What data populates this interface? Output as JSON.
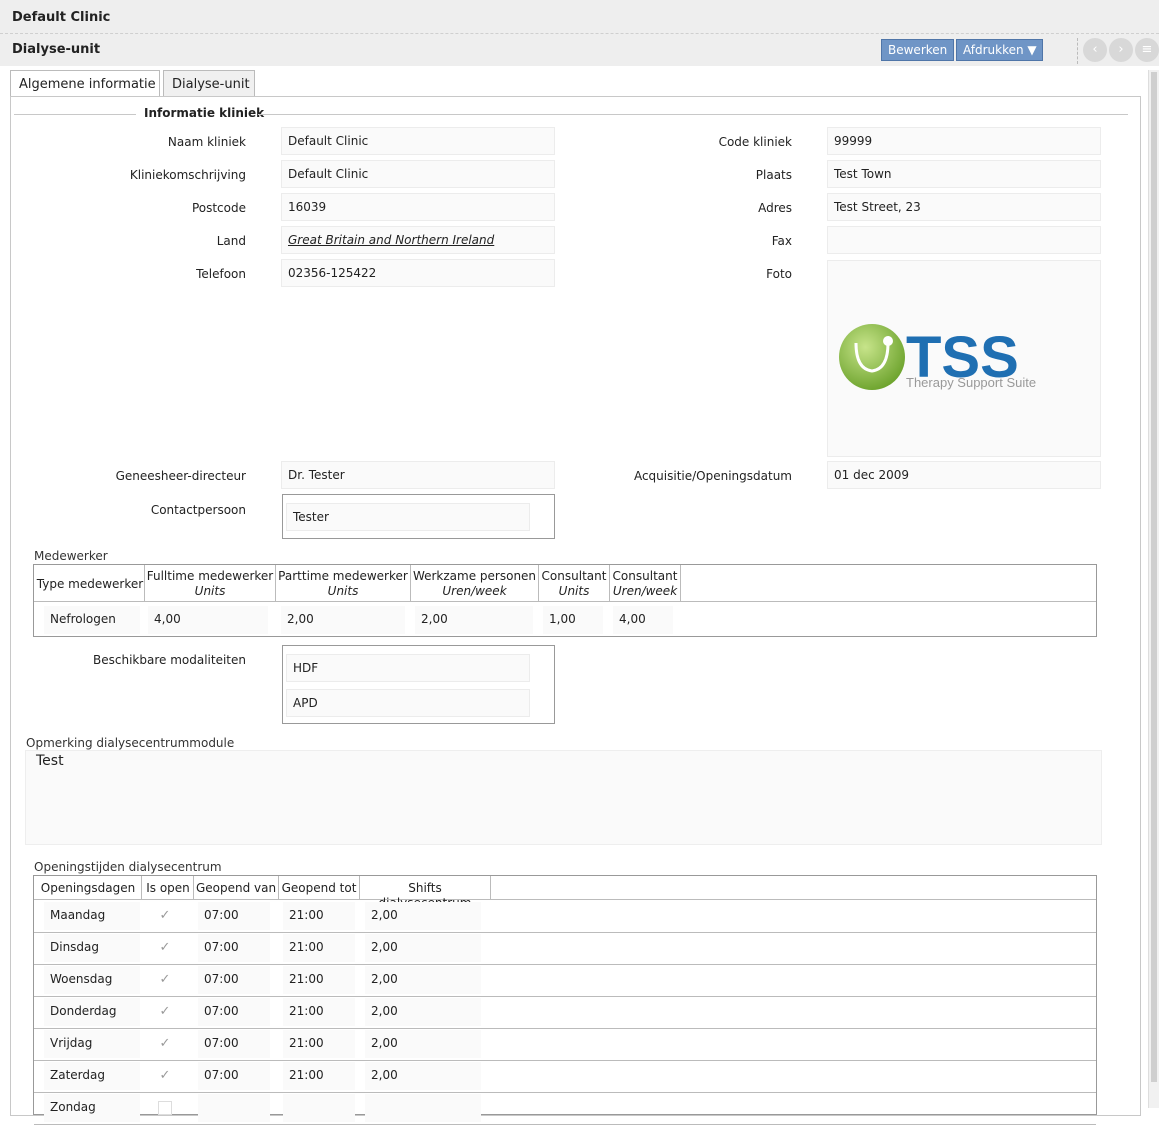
{
  "header": {
    "title": "Default Clinic",
    "subtitle": "Dialyse-unit"
  },
  "toolbar": {
    "edit_label": "Bewerken",
    "print_label": "Afdrukken ▼"
  },
  "tabs": [
    {
      "label": "Algemene informatie"
    },
    {
      "label": "Dialyse-unit"
    }
  ],
  "clinic_info": {
    "legend": "Informatie kliniek",
    "name_label": "Naam kliniek",
    "name_value": "Default Clinic",
    "desc_label": "Kliniekomschrijving",
    "desc_value": "Default Clinic",
    "postcode_label": "Postcode",
    "postcode_value": "16039",
    "country_label": "Land",
    "country_value": "Great Britain and Northern Ireland",
    "phone_label": "Telefoon",
    "phone_value": "02356-125422",
    "code_label": "Code kliniek",
    "code_value": "99999",
    "city_label": "Plaats",
    "city_value": "Test Town",
    "address_label": "Adres",
    "address_value": "Test Street, 23",
    "fax_label": "Fax",
    "fax_value": "",
    "photo_label": "Foto",
    "logo_main": "TSS",
    "logo_sub": "Therapy Support Suite",
    "director_label": "Geneesheer-directeur",
    "director_value": "Dr. Tester",
    "opening_label": "Acquisitie/Openingsdatum",
    "opening_value": "01 dec 2009",
    "contact_label": "Contactpersoon",
    "contact_value": "Tester"
  },
  "staff": {
    "legend": "Medewerker",
    "headers": {
      "type": "Type medewerker",
      "fulltime": "Fulltime medewerker",
      "fulltime_unit": "Units",
      "parttime": "Parttime medewerker",
      "parttime_unit": "Units",
      "working": "Werkzame personen",
      "working_unit": "Uren/week",
      "consultant1": "Consultant",
      "consultant1_unit": "Units",
      "consultant2": "Consultant",
      "consultant2_unit": "Uren/week"
    },
    "rows": [
      {
        "type": "Nefrologen",
        "fulltime": "4,00",
        "parttime": "2,00",
        "working": "2,00",
        "consultant_units": "1,00",
        "consultant_hours": "4,00"
      }
    ]
  },
  "modalities": {
    "label": "Beschikbare modaliteiten",
    "items": [
      "HDF",
      "APD"
    ]
  },
  "remark": {
    "label": "Opmerking dialysecentrummodule",
    "value": "Test"
  },
  "hours": {
    "legend": "Openingstijden dialysecentrum",
    "headers": {
      "day": "Openingsdagen",
      "open": "Is open",
      "from": "Geopend van",
      "to": "Geopend tot",
      "shifts": "Shifts dialysecentrum"
    },
    "rows": [
      {
        "day": "Maandag",
        "open": true,
        "from": "07:00",
        "to": "21:00",
        "shifts": "2,00"
      },
      {
        "day": "Dinsdag",
        "open": true,
        "from": "07:00",
        "to": "21:00",
        "shifts": "2,00"
      },
      {
        "day": "Woensdag",
        "open": true,
        "from": "07:00",
        "to": "21:00",
        "shifts": "2,00"
      },
      {
        "day": "Donderdag",
        "open": true,
        "from": "07:00",
        "to": "21:00",
        "shifts": "2,00"
      },
      {
        "day": "Vrijdag",
        "open": true,
        "from": "07:00",
        "to": "21:00",
        "shifts": "2,00"
      },
      {
        "day": "Zaterdag",
        "open": true,
        "from": "07:00",
        "to": "21:00",
        "shifts": "2,00"
      },
      {
        "day": "Zondag",
        "open": false,
        "from": "",
        "to": "",
        "shifts": ""
      }
    ]
  },
  "colors": {
    "button": "#6f95c6",
    "logo_green": "#8dc63f",
    "logo_blue": "#1f6fb2"
  },
  "icons": {
    "prev": "chevron-left-icon",
    "next": "chevron-right-icon",
    "menu": "menu-icon",
    "check": "check-icon"
  }
}
